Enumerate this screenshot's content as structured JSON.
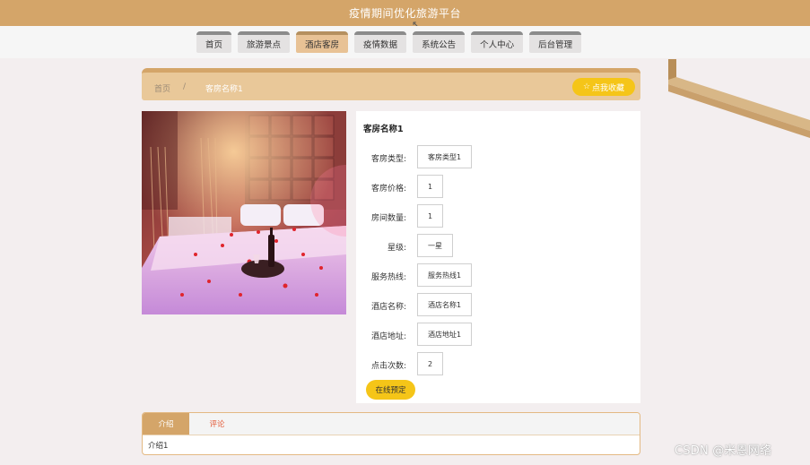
{
  "header": {
    "title": "疫情期间优化旅游平台"
  },
  "nav": {
    "items": [
      {
        "label": "首页",
        "active": false
      },
      {
        "label": "旅游景点",
        "active": false
      },
      {
        "label": "酒店客房",
        "active": true
      },
      {
        "label": "疫情数据",
        "active": false
      },
      {
        "label": "系统公告",
        "active": false
      },
      {
        "label": "个人中心",
        "active": false
      },
      {
        "label": "后台管理",
        "active": false
      }
    ]
  },
  "breadcrumb": {
    "home": "首页",
    "separator": "/",
    "current": "客房名称1"
  },
  "favorite_button": {
    "icon": "star-outline-icon",
    "label": "点我收藏"
  },
  "room": {
    "title": "客房名称1",
    "fields": [
      {
        "label": "客房类型:",
        "value": "客房类型1"
      },
      {
        "label": "客房价格:",
        "value": "1"
      },
      {
        "label": "房间数量:",
        "value": "1"
      },
      {
        "label": "星级:",
        "value": "一星"
      },
      {
        "label": "服务热线:",
        "value": "服务热线1"
      },
      {
        "label": "酒店名称:",
        "value": "酒店名称1"
      },
      {
        "label": "酒店地址:",
        "value": "酒店地址1"
      },
      {
        "label": "点击次数:",
        "value": "2"
      }
    ],
    "book_button": "在线预定"
  },
  "tabs": {
    "items": [
      {
        "label": "介绍",
        "active": true
      },
      {
        "label": "评论",
        "active": false
      }
    ],
    "content": "介绍1"
  },
  "watermark": "CSDN @米恩网络",
  "colors": {
    "accent": "#d4a569",
    "tab_active": "#e8c295",
    "button_yellow": "#f5c518",
    "comment_tab": "#e35b3a"
  }
}
